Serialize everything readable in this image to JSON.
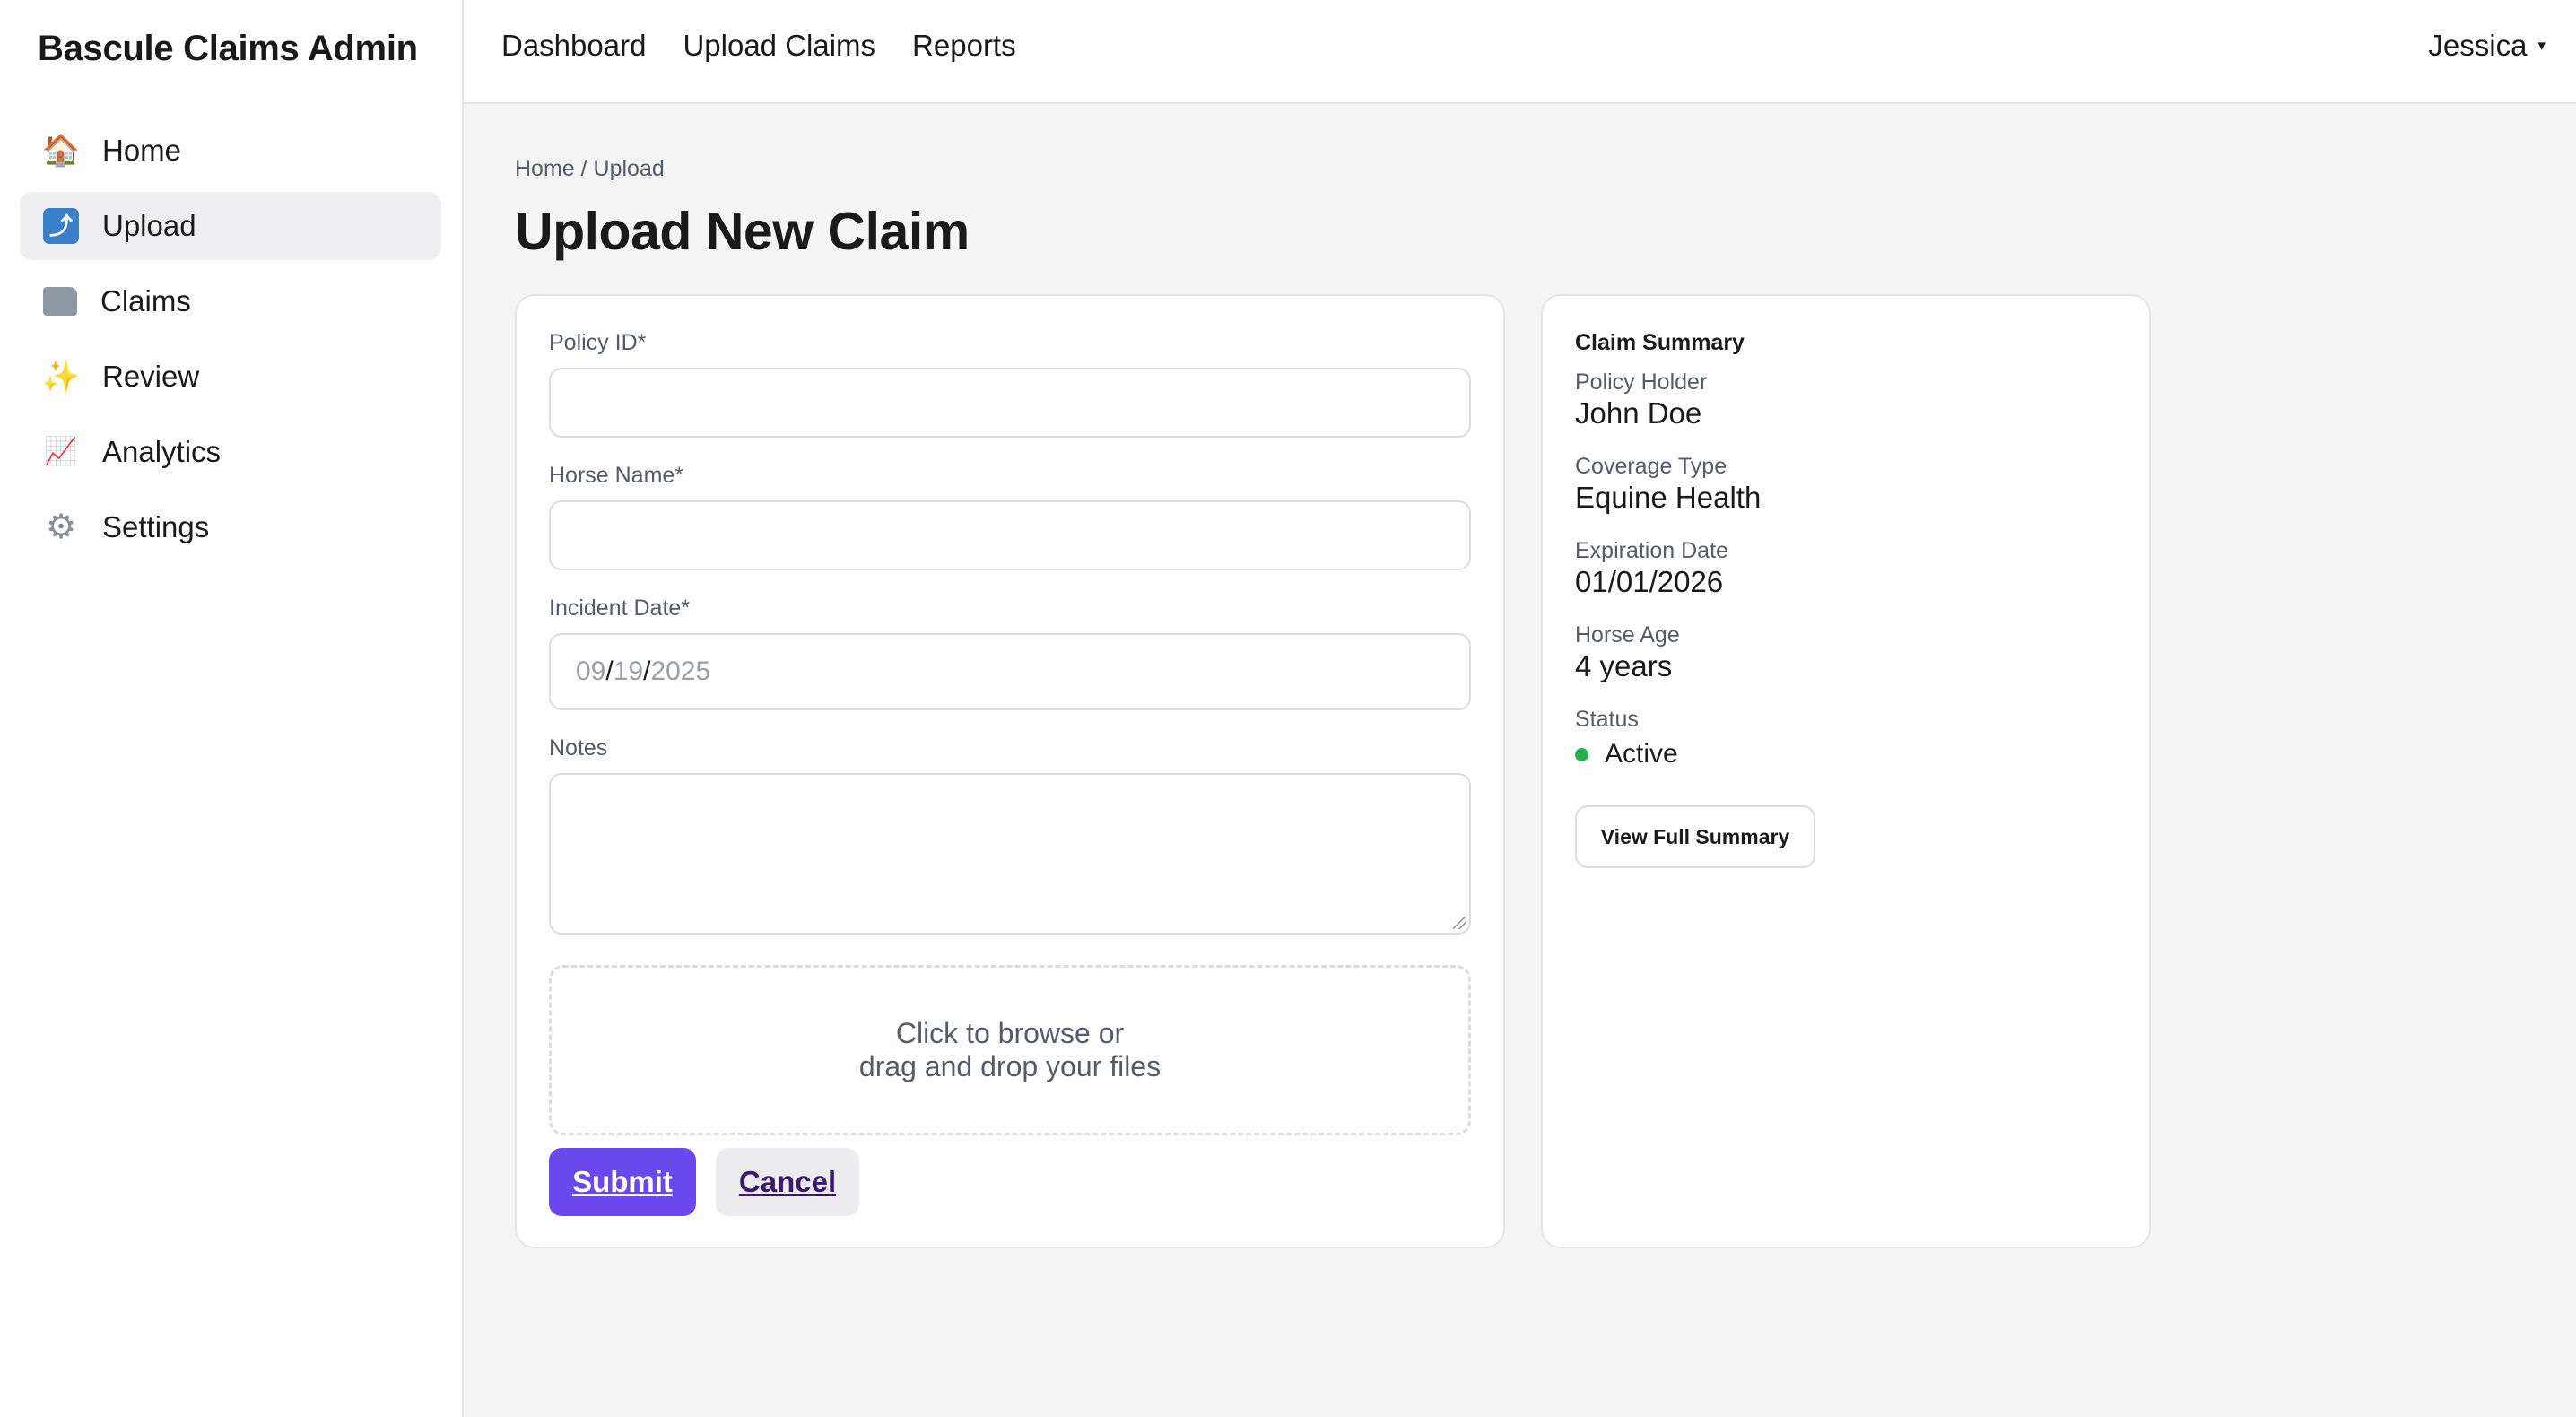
{
  "app": {
    "title": "Bascule Claims Admin"
  },
  "sidebar": {
    "items": [
      {
        "label": "Home",
        "icon": "home-icon",
        "glyph": "🏠",
        "active": false
      },
      {
        "label": "Upload",
        "icon": "upload-icon",
        "glyph": "⤴",
        "active": true
      },
      {
        "label": "Claims",
        "icon": "folder-icon",
        "glyph": "",
        "active": false
      },
      {
        "label": "Review",
        "icon": "sparkles-icon",
        "glyph": "✨",
        "active": false
      },
      {
        "label": "Analytics",
        "icon": "chart-icon",
        "glyph": "📈",
        "active": false
      },
      {
        "label": "Settings",
        "icon": "gear-icon",
        "glyph": "⚙",
        "active": false
      }
    ]
  },
  "topnav": {
    "links": [
      "Dashboard",
      "Upload Claims",
      "Reports"
    ],
    "user": "Jessica",
    "caret": "▾"
  },
  "page": {
    "breadcrumb": "Home / Upload",
    "title": "Upload New Claim"
  },
  "form": {
    "policy_id_label": "Policy ID*",
    "policy_id_value": "",
    "horse_name_label": "Horse Name*",
    "horse_name_value": "",
    "incident_date_label": "Incident Date*",
    "incident_date": {
      "month": "09",
      "day": "19",
      "year": "2025",
      "sep": "/"
    },
    "notes_label": "Notes",
    "notes_value": "",
    "dropzone_line1": "Click to browse or",
    "dropzone_line2": "drag and drop your files",
    "submit_label": "Submit",
    "cancel_label": "Cancel"
  },
  "summary": {
    "title": "Claim Summary",
    "policy_holder_label": "Policy Holder",
    "policy_holder": "John Doe",
    "coverage_type_label": "Coverage Type",
    "coverage_type": "Equine Health",
    "expiration_date_label": "Expiration Date",
    "expiration_date": "01/01/2026",
    "horse_age_label": "Horse Age",
    "horse_age": "4 years",
    "status_label": "Status",
    "status": "Active",
    "status_color": "#22b14c",
    "view_full_label": "View Full Summary"
  },
  "colors": {
    "accent": "#6b47ee",
    "cancel_text": "#3b1a6e",
    "background": "#f5f5f6"
  }
}
